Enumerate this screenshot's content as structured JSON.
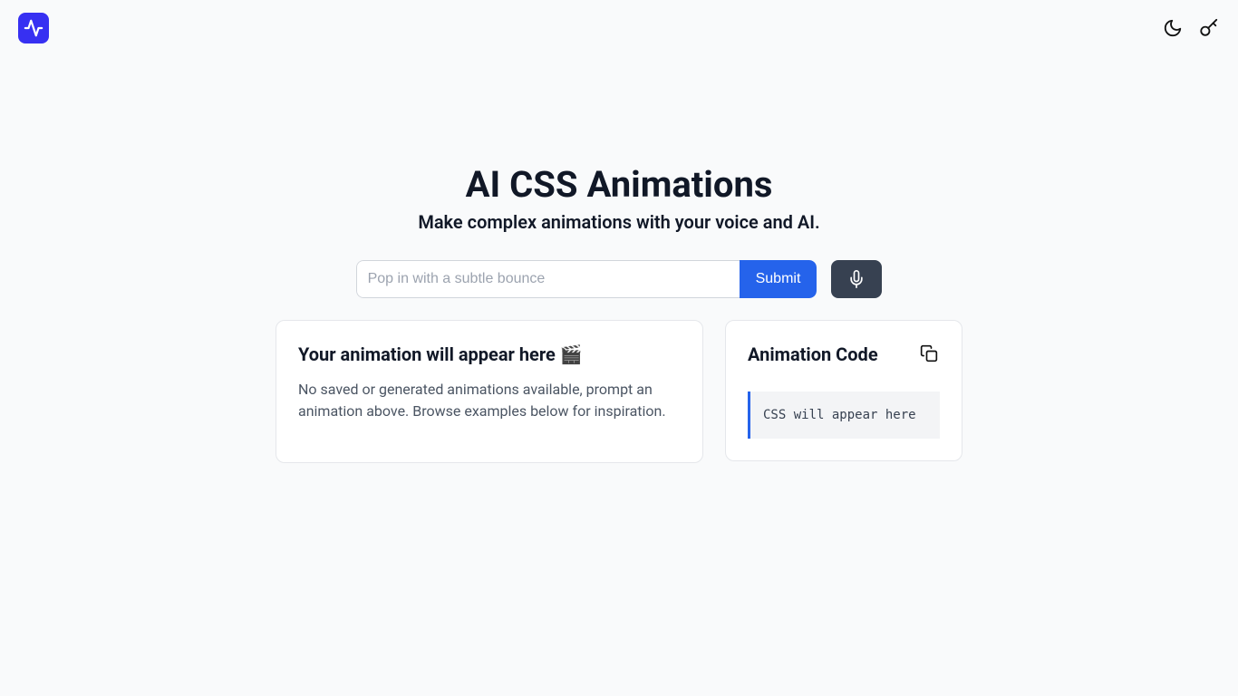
{
  "hero": {
    "title": "AI CSS Animations",
    "subtitle": "Make complex animations with your voice and AI."
  },
  "form": {
    "placeholder": "Pop in with a subtle bounce",
    "submit_label": "Submit"
  },
  "preview_panel": {
    "title": "Your animation will appear here 🎬",
    "description": "No saved or generated animations available, prompt an animation above. Browse examples below for inspiration."
  },
  "code_panel": {
    "title": "Animation Code",
    "placeholder": "CSS will appear here"
  }
}
